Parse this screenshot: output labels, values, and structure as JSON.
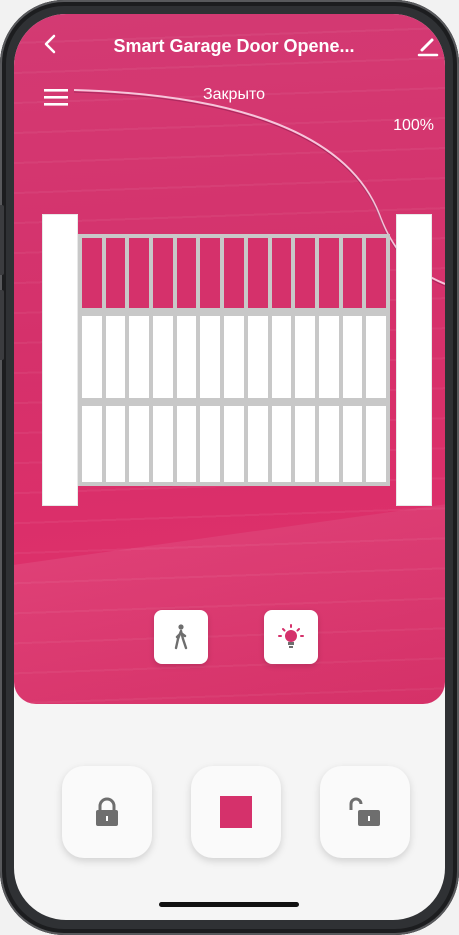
{
  "header": {
    "title": "Smart Garage Door Opene...",
    "back_icon": "chevron-left-icon",
    "edit_icon": "pencil-icon"
  },
  "status": {
    "state": "Закрыто",
    "percent": "100%",
    "open_fraction": 0.0
  },
  "menu_icon": "hamburger-menu-icon",
  "quick_actions": [
    {
      "name": "pedestrian-mode-button",
      "icon": "walking-person-icon"
    },
    {
      "name": "light-button",
      "icon": "lightbulb-icon"
    }
  ],
  "controls": [
    {
      "name": "close-button",
      "icon": "lock-closed-icon"
    },
    {
      "name": "stop-button",
      "icon": "stop-square-icon"
    },
    {
      "name": "open-button",
      "icon": "lock-open-icon"
    }
  ],
  "colors": {
    "accent": "#d5316b",
    "icon_grey": "#6e6e6e",
    "gate_frame": "#c8c8c8"
  }
}
